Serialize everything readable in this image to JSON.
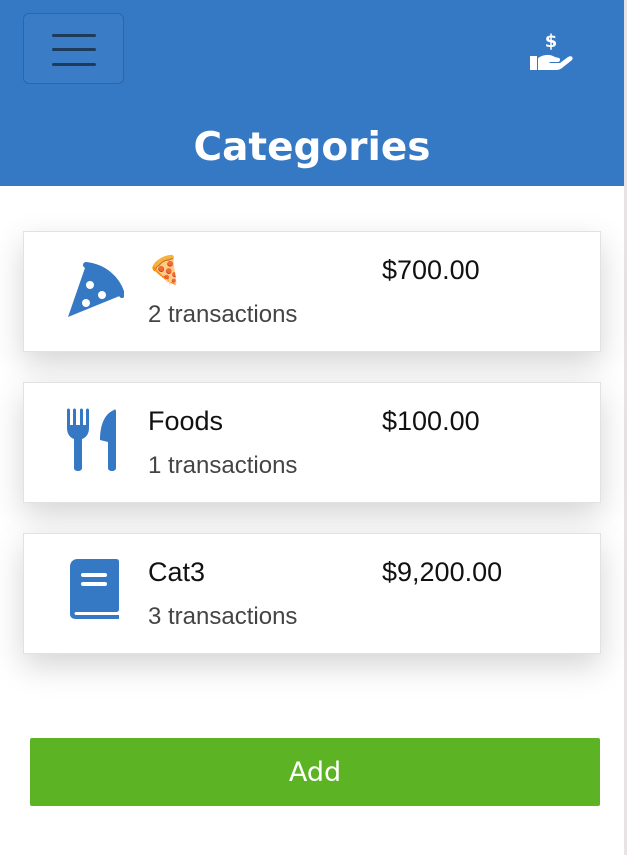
{
  "header": {
    "title": "Categories",
    "menu_icon": "hamburger-menu-icon",
    "logo_icon": "hand-dollar-icon",
    "background_color": "#3578c3"
  },
  "categories": [
    {
      "name": "🍕",
      "amount": "$700.00",
      "count": "2 transactions",
      "icon": "pizza-icon"
    },
    {
      "name": "Foods",
      "amount": "$100.00",
      "count": "1 transactions",
      "icon": "utensils-icon"
    },
    {
      "name": "Cat3",
      "amount": "$9,200.00",
      "count": "3 transactions",
      "icon": "book-icon"
    }
  ],
  "actions": {
    "add_label": "Add",
    "add_color": "#5cb324"
  },
  "colors": {
    "icon_color": "#3578c3"
  }
}
